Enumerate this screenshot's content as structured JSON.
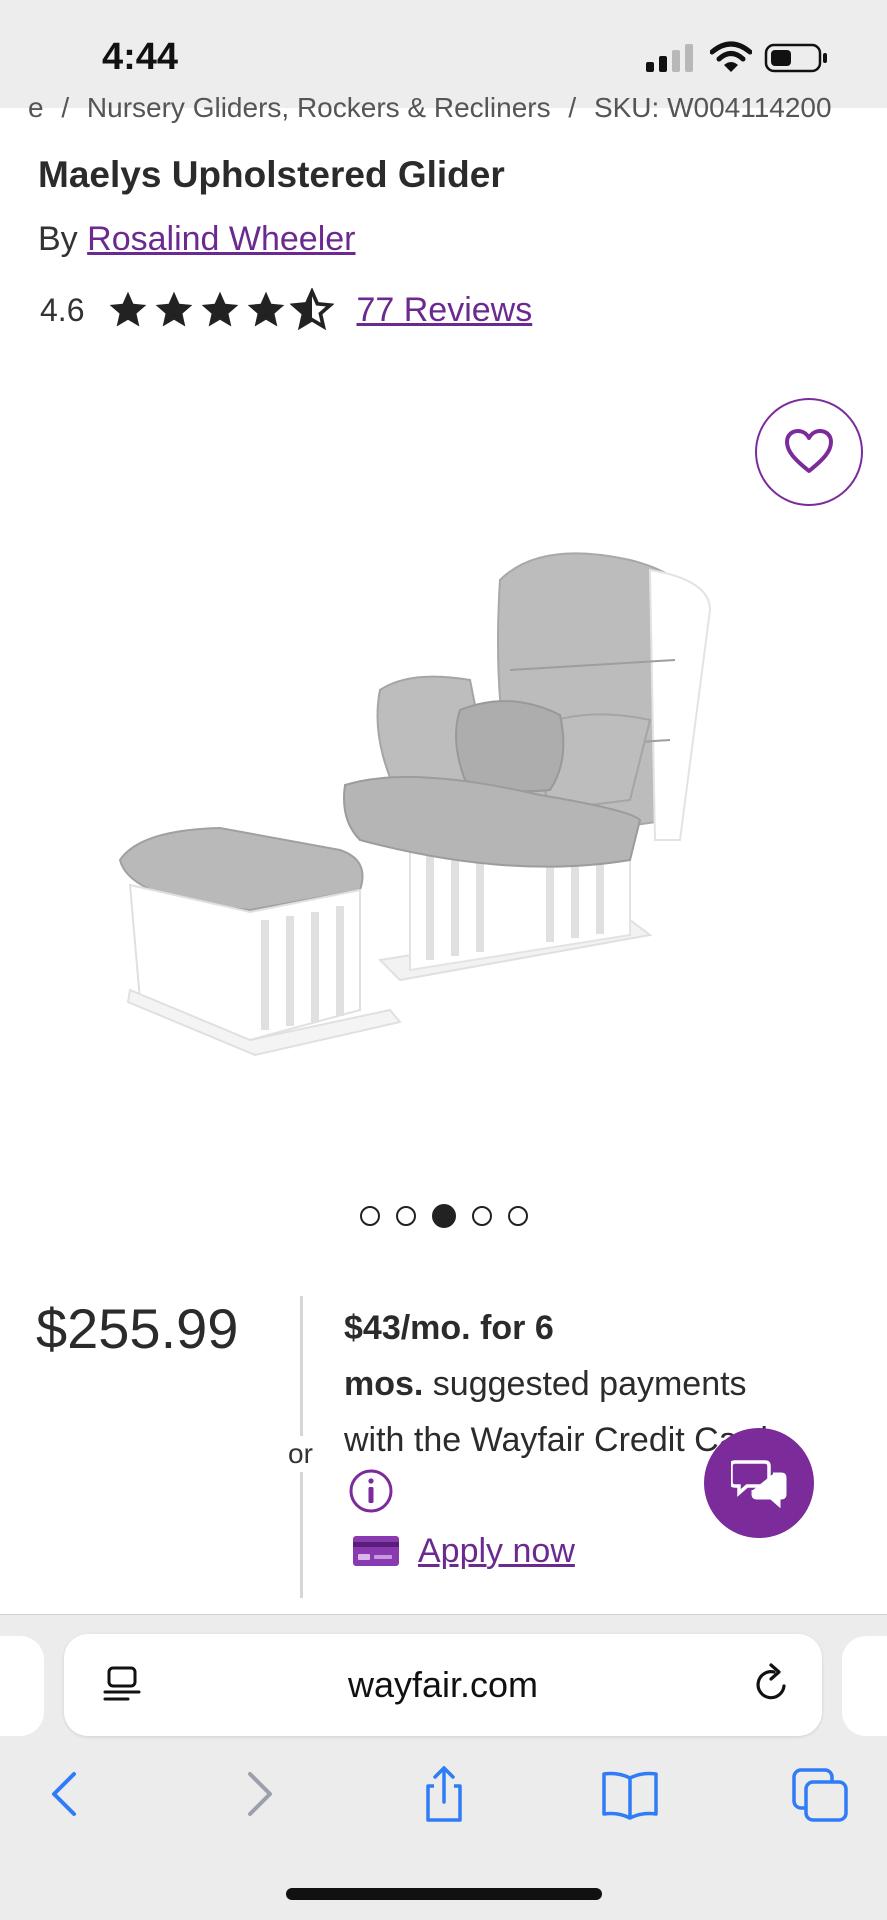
{
  "status_bar": {
    "time": "4:44",
    "icons": [
      "signal-icon",
      "wifi-icon",
      "battery-icon"
    ]
  },
  "breadcrumb": {
    "items": [
      "e",
      "/",
      "Nursery Gliders, Rockers & Recliners",
      "/",
      "SKU: W004114200"
    ]
  },
  "product": {
    "title": "Maelys Upholstered Glider",
    "by_prefix": "By",
    "brand": "Rosalind Wheeler",
    "rating": "4.6",
    "rating_value": 4.6,
    "rating_max": 5,
    "reviews": "77 Reviews",
    "image_icon": "glider-chair-with-ottoman-image",
    "carousel": {
      "count": 5,
      "active_index": 2
    }
  },
  "pricing": {
    "price": "$255.99",
    "or": "or",
    "finance_bold_1": "$43/mo. for 6",
    "finance_bold_2": "mos.",
    "finance_rest_1": " suggested payments",
    "finance_rest_2": "with the Wayfair Credit Card",
    "apply": "Apply now"
  },
  "browser": {
    "url": "wayfair.com",
    "toolbar": [
      "back-icon",
      "forward-icon",
      "share-icon",
      "bookmarks-icon",
      "tabs-icon"
    ]
  },
  "colors": {
    "brand_purple": "#7b2b9a",
    "link_purple": "#6b2a8f",
    "safari_blue": "#2f7cf6"
  }
}
